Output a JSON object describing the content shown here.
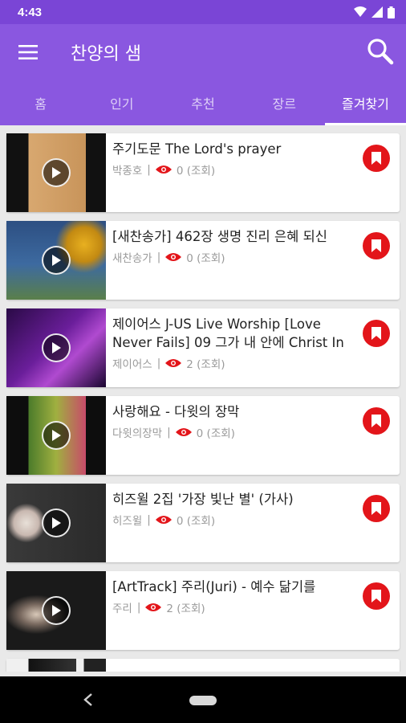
{
  "status": {
    "time": "4:43"
  },
  "appbar": {
    "title": "찬양의 샘",
    "menu_icon": "menu-icon",
    "search_icon": "search-icon"
  },
  "tabs": [
    {
      "label": "홈"
    },
    {
      "label": "인기"
    },
    {
      "label": "추천"
    },
    {
      "label": "장르"
    },
    {
      "label": "즐겨찾기",
      "active": true
    }
  ],
  "colors": {
    "primary": "#8a57e0",
    "status": "#7a45d6",
    "bookmark": "#e3151a"
  },
  "videos": [
    {
      "title": "주기도문 The Lord's prayer",
      "channel": "박종호",
      "views": "0 (조회)"
    },
    {
      "title": "[새찬송가] 462장 생명 진리 은혜 되신",
      "channel": "새찬송가",
      "views": "0 (조회)"
    },
    {
      "title": "제이어스 J-US Live Worship [Love Never Fails] 09 그가 내 안에 Christ In",
      "channel": "제이어스",
      "views": "2 (조회)"
    },
    {
      "title": "사랑해요 - 다윗의 장막",
      "channel": "다윗의장막",
      "views": "0 (조회)"
    },
    {
      "title": "히즈윌 2집 '가장 빛난 별' (가사)",
      "channel": "히즈윌",
      "views": "0 (조회)"
    },
    {
      "title": "[ArtTrack] 주리(Juri) - 예수 닮기를",
      "channel": "주리",
      "views": "2 (조회)"
    }
  ]
}
